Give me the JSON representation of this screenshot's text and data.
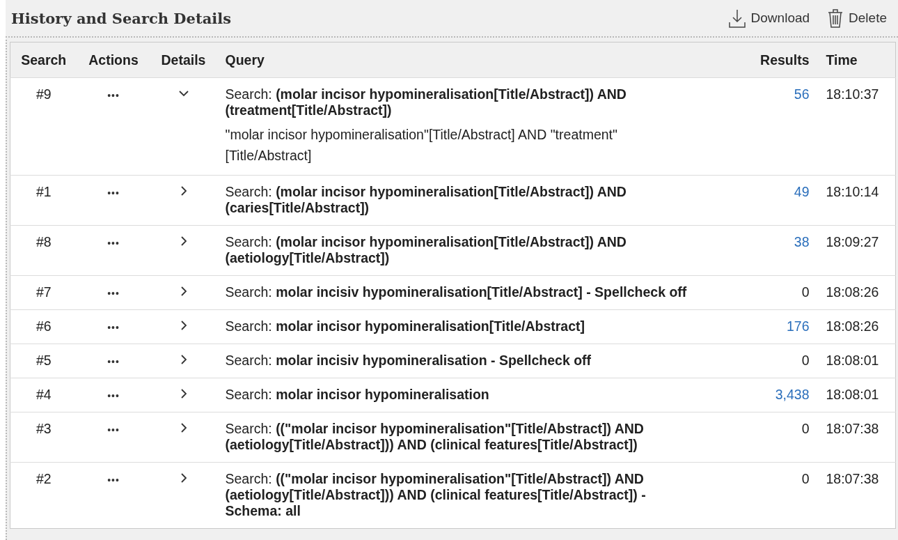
{
  "title": "History and Search Details",
  "toolbar": [
    {
      "kind": "download",
      "label": "Download"
    },
    {
      "kind": "delete",
      "label": "Delete"
    }
  ],
  "columns": [
    {
      "label": "Search"
    },
    {
      "label": "Actions"
    },
    {
      "label": "Details"
    },
    {
      "label": "Query"
    },
    {
      "label": "Results"
    },
    {
      "label": "Time"
    }
  ],
  "rows": [
    {
      "number": "#9",
      "actions": "•••",
      "expanded": true,
      "query": "Search: **(molar incisor hypomineralisation[Title/Abstract]) AND (treatment[Title/Abstract])**",
      "details": "\"molar incisor hypomineralisation\"[Title/Abstract] AND \"treatment\"[Title/Abstract]",
      "results": "56",
      "link": true,
      "time": "18:10:37"
    },
    {
      "number": "#1",
      "actions": "•••",
      "expanded": false,
      "query": "Search: **(molar incisor hypomineralisation[Title/Abstract]) AND (caries[Title/Abstract])**",
      "results": "49",
      "link": true,
      "time": "18:10:14"
    },
    {
      "number": "#8",
      "actions": "•••",
      "expanded": false,
      "query": "Search: **(molar incisor hypomineralisation[Title/Abstract]) AND (aetiology[Title/Abstract])**",
      "results": "38",
      "link": true,
      "time": "18:09:27"
    },
    {
      "number": "#7",
      "actions": "•••",
      "expanded": false,
      "query": "Search: **molar incisiv hypomineralisation[Title/Abstract] - Spellcheck off**",
      "results": "0",
      "link": false,
      "time": "18:08:26"
    },
    {
      "number": "#6",
      "actions": "•••",
      "expanded": false,
      "query": "Search: **molar incisor hypomineralisation[Title/Abstract]**",
      "results": "176",
      "link": true,
      "time": "18:08:26"
    },
    {
      "number": "#5",
      "actions": "•••",
      "expanded": false,
      "query": "Search: **molar incisiv hypomineralisation - Spellcheck off**",
      "results": "0",
      "link": false,
      "time": "18:08:01"
    },
    {
      "number": "#4",
      "actions": "•••",
      "expanded": false,
      "query": "Search: **molar incisor hypomineralisation**",
      "results": "3,438",
      "link": true,
      "time": "18:08:01"
    },
    {
      "number": "#3",
      "actions": "•••",
      "expanded": false,
      "query": "Search: **((\"molar incisor hypomineralisation\"[Title/Abstract]) AND (aetiology[Title/Abstract])) AND (clinical features[Title/Abstract])**",
      "results": "0",
      "link": false,
      "time": "18:07:38"
    },
    {
      "number": "#2",
      "actions": "•••",
      "expanded": false,
      "query": "Search: **((\"molar incisor hypomineralisation\"[Title/Abstract]) AND (aetiology[Title/Abstract])) AND (clinical features[Title/Abstract]) - Schema: all**",
      "results": "0",
      "link": false,
      "time": "18:07:38"
    }
  ]
}
